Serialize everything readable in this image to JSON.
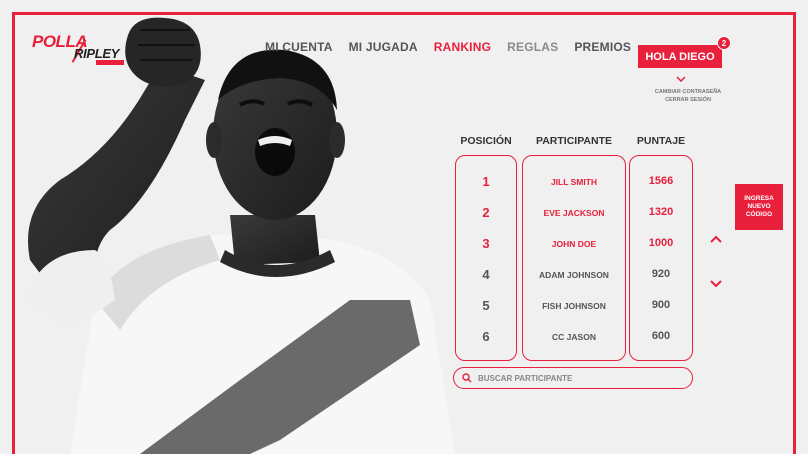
{
  "brand": {
    "logo_top": "POLLA",
    "logo_bottom": "RIPLEY"
  },
  "nav": {
    "items": [
      {
        "label": "MI CUENTA",
        "state": "normal"
      },
      {
        "label": "MI JUGADA",
        "state": "normal"
      },
      {
        "label": "RANKING",
        "state": "active"
      },
      {
        "label": "REGLAS",
        "state": "dim"
      },
      {
        "label": "PREMIOS",
        "state": "normal"
      }
    ]
  },
  "user": {
    "greeting": "HOLA DIEGO",
    "notifications": "2",
    "change_password": "CAMBIAR CONTRASEÑA",
    "logout": "CERRAR SESIÓN"
  },
  "ranking": {
    "headers": {
      "position": "POSICIÓN",
      "participant": "PARTICIPANTE",
      "score": "PUNTAJE"
    },
    "rows": [
      {
        "position": "1",
        "name": "JILL SMITH",
        "score": "1566",
        "highlight": true
      },
      {
        "position": "2",
        "name": "EVE JACKSON",
        "score": "1320",
        "highlight": true
      },
      {
        "position": "3",
        "name": "JOHN DOE",
        "score": "1000",
        "highlight": true
      },
      {
        "position": "4",
        "name": "ADAM JOHNSON",
        "score": "920",
        "highlight": false
      },
      {
        "position": "5",
        "name": "FISH JOHNSON",
        "score": "900",
        "highlight": false
      },
      {
        "position": "6",
        "name": "CC JASON",
        "score": "600",
        "highlight": false
      }
    ]
  },
  "search": {
    "placeholder": "BUSCAR PARTICIPANTE"
  },
  "code_button": {
    "line1": "INGRESA",
    "line2": "NUEVO",
    "line3": "CÓDIGO"
  },
  "colors": {
    "accent": "#e8203c",
    "background": "#f0f0f0",
    "text": "#555555"
  },
  "icons": {
    "scroll_up": "chevron-up-icon",
    "scroll_down": "chevron-down-icon",
    "search": "search-icon",
    "menu_caret": "chevron-down-icon"
  }
}
